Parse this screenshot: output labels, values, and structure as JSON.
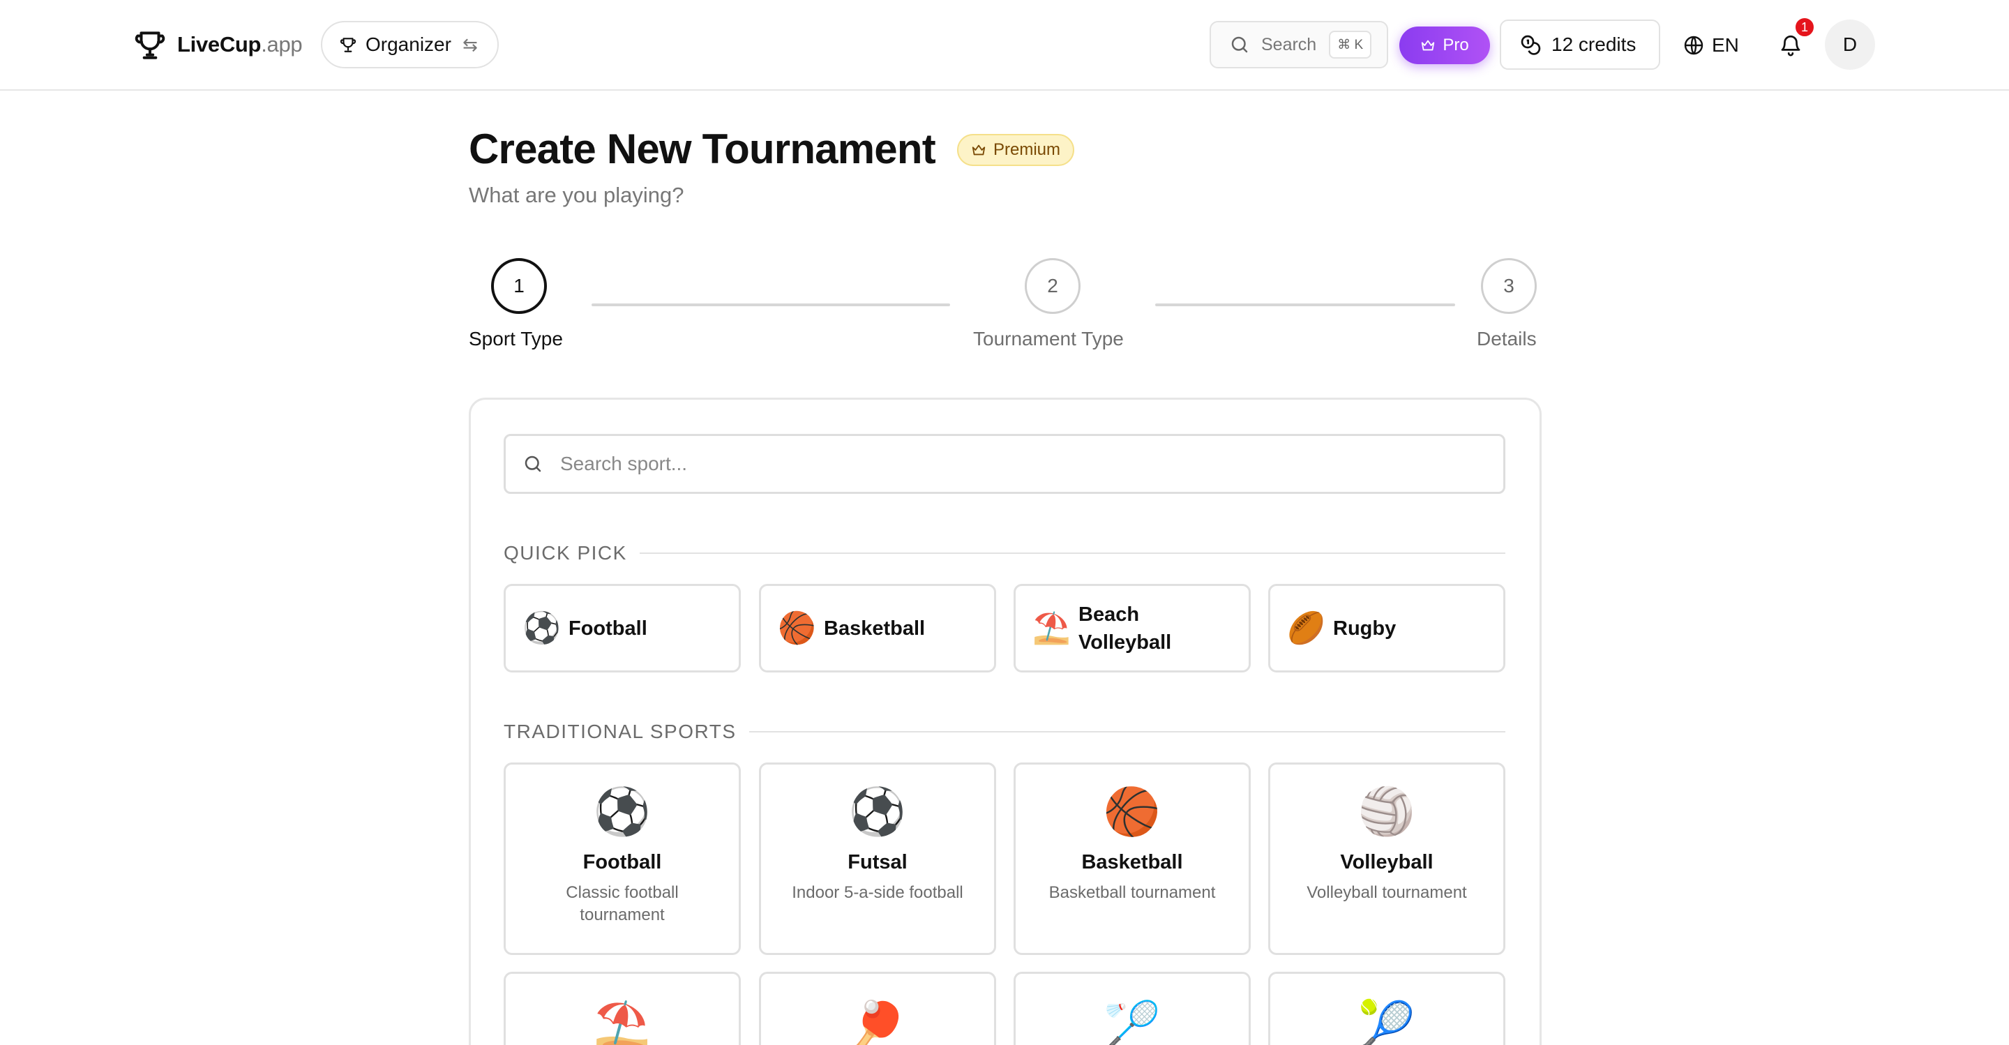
{
  "header": {
    "logo": {
      "name": "LiveCup",
      "suffix": ".app",
      "icon": "trophy-icon"
    },
    "role": {
      "label": "Organizer",
      "icon": "trophy-icon",
      "swap_icon": "swap-icon",
      "swap_glyph": "⇆"
    },
    "search": {
      "label": "Search",
      "shortcut": "⌘ K",
      "icon": "search-icon"
    },
    "pro": {
      "label": "Pro",
      "icon": "crown-icon"
    },
    "credits": {
      "label": "12 credits",
      "icon": "coins-icon"
    },
    "language": {
      "label": "EN",
      "icon": "globe-icon"
    },
    "notifications": {
      "count": "1",
      "icon": "bell-icon"
    },
    "avatar": {
      "initial": "D"
    }
  },
  "page": {
    "title": "Create New Tournament",
    "badge": "Premium",
    "subtitle": "What are you playing?"
  },
  "stepper": {
    "steps": [
      {
        "number": "1",
        "label": "Sport Type",
        "state": "active"
      },
      {
        "number": "2",
        "label": "Tournament Type",
        "state": "inactive"
      },
      {
        "number": "3",
        "label": "Details",
        "state": "inactive"
      }
    ]
  },
  "sport_search": {
    "placeholder": "Search sport..."
  },
  "quick_pick": {
    "heading": "QUICK PICK",
    "items": [
      {
        "emoji": "⚽",
        "label": "Football"
      },
      {
        "emoji": "🏀",
        "label": "Basketball"
      },
      {
        "emoji": "⛱️",
        "label": "Beach Volleyball"
      },
      {
        "emoji": "🏉",
        "label": "Rugby"
      }
    ]
  },
  "traditional": {
    "heading": "TRADITIONAL SPORTS",
    "items": [
      {
        "emoji": "⚽",
        "name": "Football",
        "description": "Classic football tournament"
      },
      {
        "emoji": "⚽",
        "name": "Futsal",
        "description": "Indoor 5-a-side football"
      },
      {
        "emoji": "🏀",
        "name": "Basketball",
        "description": "Basketball tournament"
      },
      {
        "emoji": "🏐",
        "name": "Volleyball",
        "description": "Volleyball tournament"
      },
      {
        "emoji": "⛱️"
      },
      {
        "emoji": "🏓"
      },
      {
        "emoji": "🏸"
      },
      {
        "emoji": "🎾"
      }
    ]
  },
  "colors": {
    "pro_gradient_start": "#8b3cf0",
    "pro_gradient_end": "#b052f5",
    "notification_badge": "#e5141c",
    "premium_bg": "#fdf3c7",
    "premium_text": "#7a4a05",
    "active_step": "#111111",
    "inactive_step": "#cfcfcf"
  }
}
